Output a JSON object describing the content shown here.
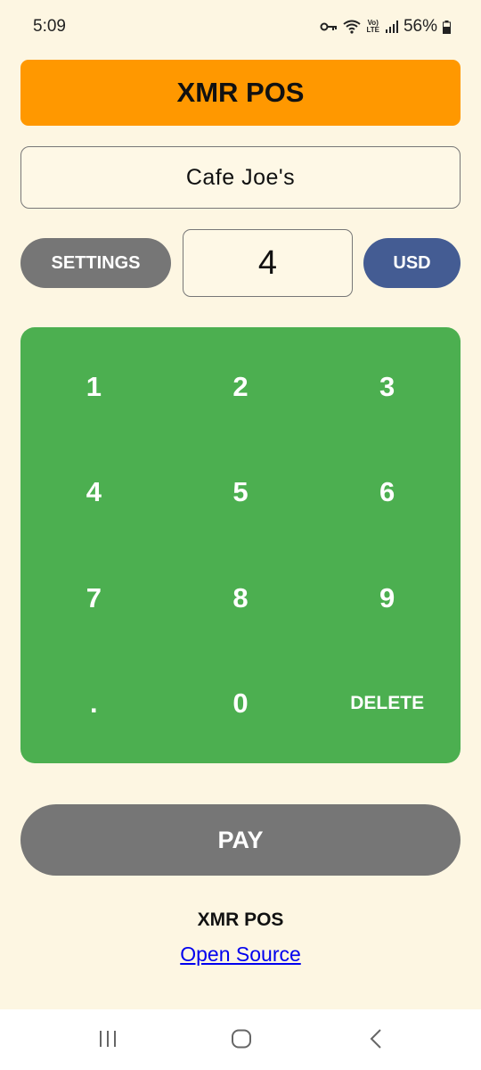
{
  "status_bar": {
    "time": "5:09",
    "network": "LTE",
    "battery": "56%"
  },
  "header": {
    "title": "XMR POS"
  },
  "store": {
    "name": "Cafe Joe's"
  },
  "controls": {
    "settings_label": "SETTINGS",
    "amount": "4",
    "currency_label": "USD"
  },
  "keypad": {
    "keys": [
      "1",
      "2",
      "3",
      "4",
      "5",
      "6",
      "7",
      "8",
      "9",
      ".",
      "0",
      "DELETE"
    ]
  },
  "pay": {
    "label": "PAY"
  },
  "footer": {
    "title": "XMR POS",
    "link": "Open Source"
  },
  "colors": {
    "background": "#fdf6e2",
    "header": "#ff9800",
    "keypad": "#4caf50",
    "button_gray": "#767676",
    "currency": "#445c93",
    "link": "#0000ee"
  },
  "nav_icons": [
    "recents-icon",
    "home-icon",
    "back-icon"
  ]
}
